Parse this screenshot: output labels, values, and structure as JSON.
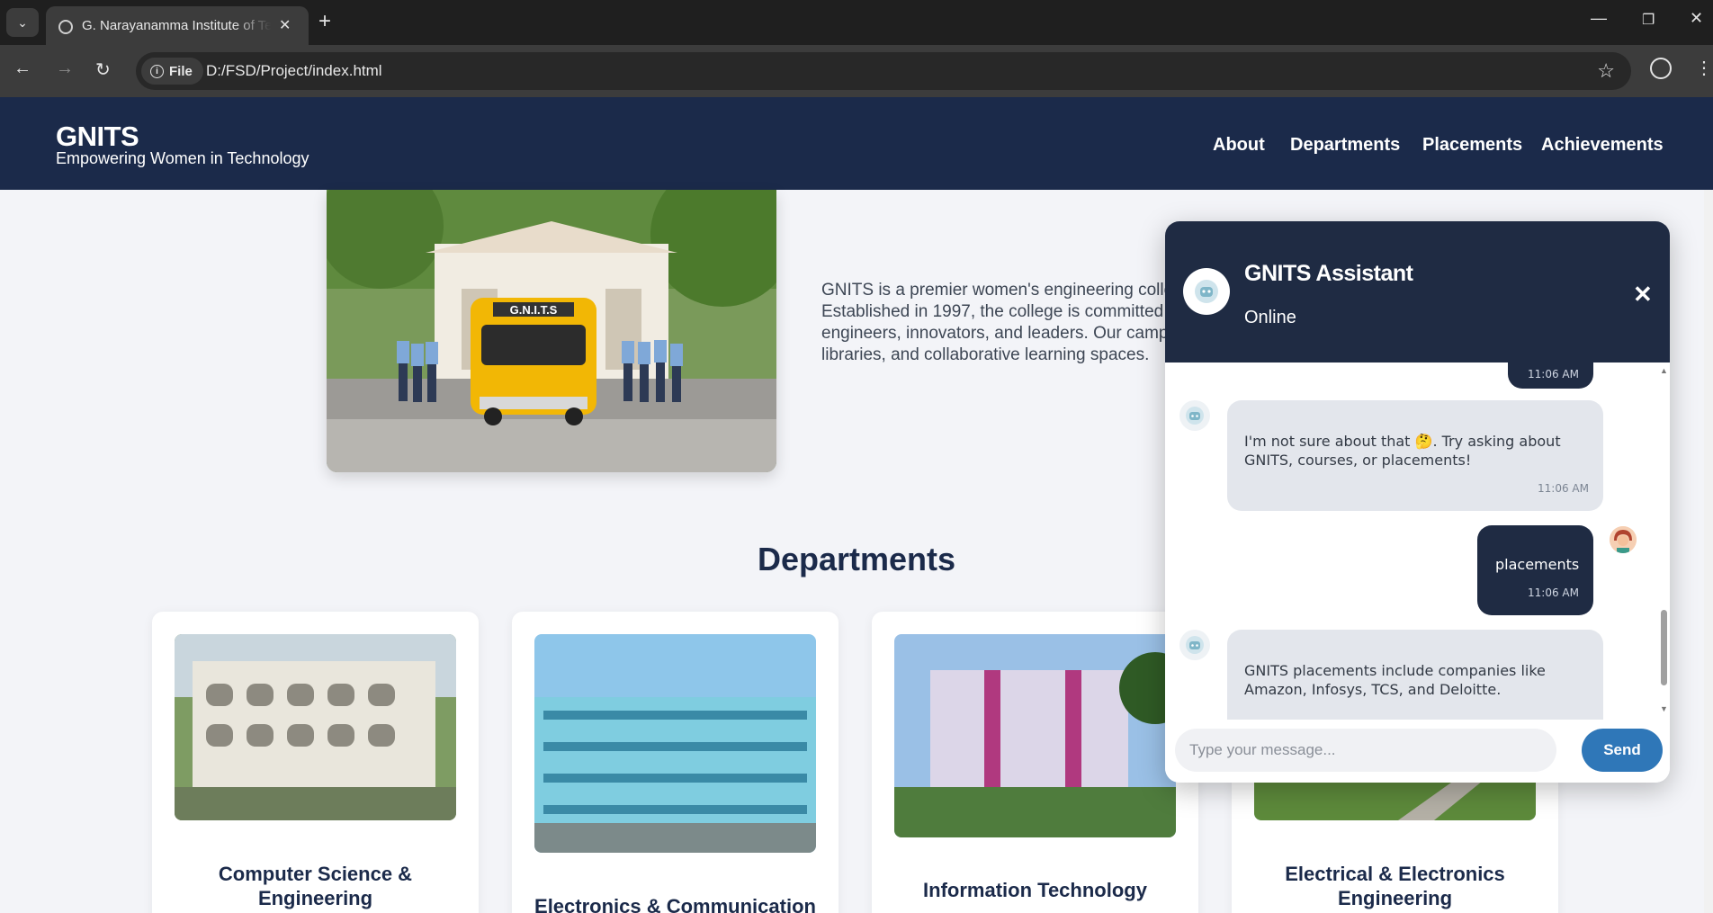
{
  "browser": {
    "tab_title": "G. Narayanamma Institute of Technology",
    "url_scheme": "File",
    "url": "D:/FSD/Project/index.html"
  },
  "site": {
    "brand": "GNITS",
    "tagline": "Empowering Women in Technology",
    "nav": [
      "About",
      "Departments",
      "Placements",
      "Achievements"
    ]
  },
  "about": {
    "lines": [
      "GNITS is a premier women's engineering college",
      "Established in 1997, the college is committed",
      "engineers, innovators, and leaders. Our camp",
      "libraries, and collaborative learning spaces."
    ]
  },
  "departments": {
    "title": "Departments",
    "cards": [
      {
        "name": "Computer Science & Engineering"
      },
      {
        "name": "Electronics & Communication"
      },
      {
        "name": "Information Technology"
      },
      {
        "name": "Electrical & Electronics Engineering"
      }
    ]
  },
  "chat": {
    "title": "GNITS Assistant",
    "status": "Online",
    "messages": [
      {
        "from": "user",
        "text": "",
        "time": "11:06 AM"
      },
      {
        "from": "bot",
        "text": "I'm not sure about that 🤔. Try asking about GNITS, courses, or placements!",
        "time": "11:06 AM"
      },
      {
        "from": "user",
        "text": "placements",
        "time": "11:06 AM"
      },
      {
        "from": "bot",
        "text": "GNITS placements include companies like Amazon, Infosys, TCS, and Deloitte.",
        "time": ""
      }
    ],
    "input_placeholder": "Type your message...",
    "send_label": "Send"
  }
}
